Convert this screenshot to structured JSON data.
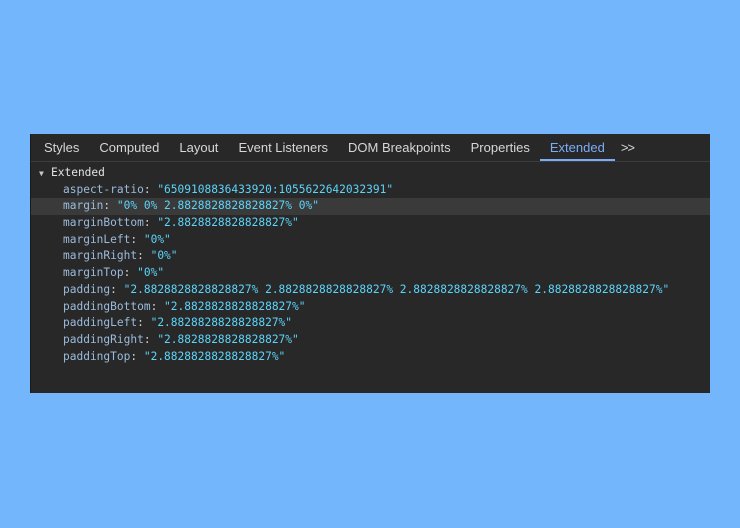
{
  "tabs": [
    {
      "label": "Styles",
      "active": false
    },
    {
      "label": "Computed",
      "active": false
    },
    {
      "label": "Layout",
      "active": false
    },
    {
      "label": "Event Listeners",
      "active": false
    },
    {
      "label": "DOM Breakpoints",
      "active": false
    },
    {
      "label": "Properties",
      "active": false
    },
    {
      "label": "Extended",
      "active": true
    }
  ],
  "more_tabs_label": ">>",
  "section": {
    "title": "Extended",
    "expanded": true,
    "properties": [
      {
        "key": "aspect-ratio",
        "value": "\"6509108836433920:1055622642032391\""
      },
      {
        "key": "margin",
        "value": "\"0% 0% 2.8828828828828827% 0%\""
      },
      {
        "key": "marginBottom",
        "value": "\"2.8828828828828827%\""
      },
      {
        "key": "marginLeft",
        "value": "\"0%\""
      },
      {
        "key": "marginRight",
        "value": "\"0%\""
      },
      {
        "key": "marginTop",
        "value": "\"0%\""
      },
      {
        "key": "padding",
        "value": "\"2.8828828828828827% 2.8828828828828827% 2.8828828828828827% 2.8828828828828827%\""
      },
      {
        "key": "paddingBottom",
        "value": "\"2.8828828828828827%\""
      },
      {
        "key": "paddingLeft",
        "value": "\"2.8828828828828827%\""
      },
      {
        "key": "paddingRight",
        "value": "\"2.8828828828828827%\""
      },
      {
        "key": "paddingTop",
        "value": "\"2.8828828828828827%\""
      }
    ]
  },
  "colors": {
    "background": "#74b6fb",
    "panel": "#282828",
    "accent": "#7cacf8",
    "property_key": "#9bbbdc",
    "property_value": "#5cd5fb"
  }
}
